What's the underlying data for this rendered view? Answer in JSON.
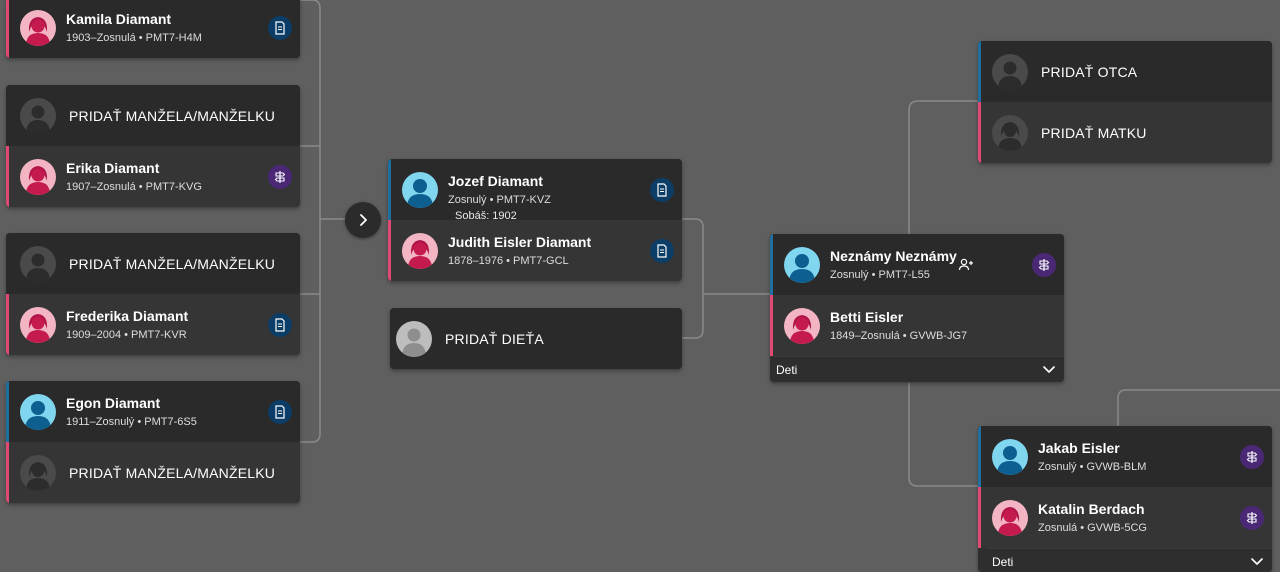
{
  "colors": {
    "background": "#5f5f5f",
    "card": "#2e2e2e",
    "male_accent": "#1d6fa0",
    "female_accent": "#e04a72",
    "badge_record": "#0b3d66",
    "badge_source": "#4a2876",
    "connector": "#8a8a8a"
  },
  "children": {
    "kamila": {
      "name": "Kamila Diamant",
      "meta": "1903–Zosnulá • PMT7-H4M",
      "badge": "record-hint-icon"
    },
    "erika_spouse": {
      "label": "PRIDAŤ MANŽELA/MANŽELKU"
    },
    "erika": {
      "name": "Erika Diamant",
      "meta": "1907–Zosnulá • PMT7-KVG",
      "badge": "source-icon"
    },
    "frederika_spouse": {
      "label": "PRIDAŤ MANŽELA/MANŽELKU"
    },
    "frederika": {
      "name": "Frederika Diamant",
      "meta": "1909–2004 • PMT7-KVR",
      "badge": "record-hint-icon"
    },
    "egon": {
      "name": "Egon Diamant",
      "meta": "1911–Zosnulý • PMT7-6S5",
      "badge": "record-hint-icon"
    },
    "egon_spouse": {
      "label": "PRIDAŤ MANŽELA/MANŽELKU"
    }
  },
  "focus_couple": {
    "husband": {
      "name": "Jozef Diamant",
      "meta": "Zosnulý • PMT7-KVZ"
    },
    "marriage": "Sobáš: 1902",
    "wife": {
      "name": "Judith Eisler Diamant",
      "meta": "1878–1976 • PMT7-GCL"
    },
    "add_child": "PRIDAŤ DIEŤA"
  },
  "parents_couple": {
    "father": {
      "name": "Neznámy Neznámy",
      "meta": "Zosnulý • PMT7-L55"
    },
    "mother": {
      "name": "Betti Eisler",
      "meta": "1849–Zosnulá • GVWB-JG7"
    },
    "deti": "Deti"
  },
  "grandparents_top": {
    "add_father": "PRIDAŤ OTCA",
    "add_mother": "PRIDAŤ MATKU"
  },
  "grandparents_bottom": {
    "father": {
      "name": "Jakab Eisler",
      "meta": "Zosnulý • GVWB-BLM"
    },
    "mother": {
      "name": "Katalin Berdach",
      "meta": "Zosnulá • GVWB-5CG"
    },
    "deti": "Deti"
  }
}
